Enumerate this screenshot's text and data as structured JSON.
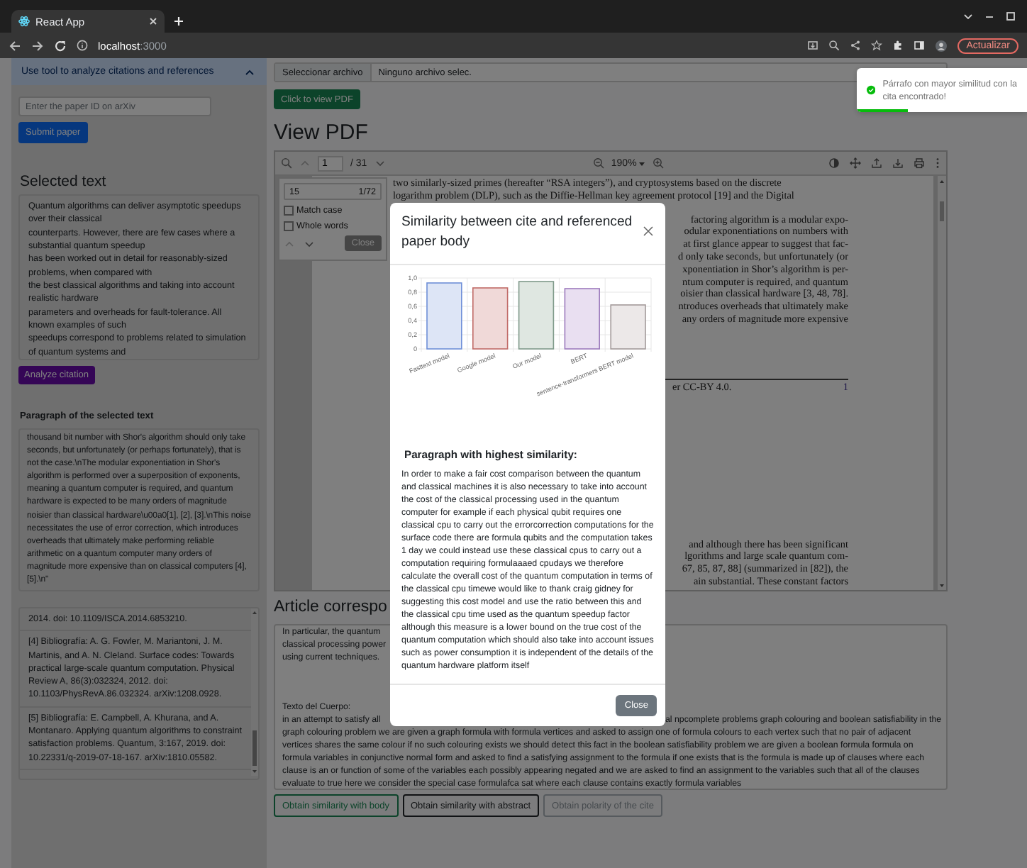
{
  "browser": {
    "tab_title": "React App",
    "address_host": "localhost",
    "address_port": ":3000",
    "update_button": "Actualizar"
  },
  "sidebar": {
    "accordion": {
      "title": "Use tool to analyze citations and references",
      "expanded": true
    },
    "paper_id_field": {
      "placeholder": "Enter the paper ID on arXiv"
    },
    "submit_button": "Submit paper",
    "selected_text_heading": "Selected text",
    "selected_text": "Quantum algorithms can deliver asymptotic speedups over their classical\ncounterparts. However, there are few cases where a substantial quantum speedup\nhas been worked out in detail for reasonably-sized problems, when compared with\nthe best classical algorithms and taking into account realistic hardware\nparameters and overheads for fault-tolerance. All known examples of such\nspeedups correspond to problems related to simulation of quantum systems and",
    "analyze_button": "Analyze citation",
    "paragraph_heading": "Paragraph of the selected text",
    "paragraph_text": "thousand bit number with Shor's algorithm should only take seconds, but unfortunately (or perhaps fortunately), that is not the case.\\nThe modular exponentiation in Shor's algorithm is performed over a superposition of exponents, meaning a quantum computer is required, and quantum hardware is expected to be many orders of magnitude noisier than classical hardware\\u00a0[1], [2], [3].\\nThis noise necessitates the use of error correction, which introduces overheads that ultimately make performing reliable arithmetic on a quantum computer many orders of magnitude more expensive than on classical computers [4], [5].\\n\"",
    "references": [
      "2014. doi: 10.1109/ISCA.2014.6853210.",
      "[4] Bibliografía: A. G. Fowler, M. Mariantoni, J. M. Martinis, and A. N. Cleland. Surface codes: Towards practical large-scale quantum computation. Physical Review A, 86(3):032324, 2012. doi: 10.1103/PhysRevA.86.032324. arXiv:1208.0928.",
      "[5] Bibliografía: E. Campbell, A. Khurana, and A. Montanaro. Applying quantum algorithms to constraint satisfaction problems. Quantum, 3:167, 2019. doi: 10.22331/q-2019-07-18-167. arXiv:1810.05582."
    ]
  },
  "file_input": {
    "button": "Seleccionar archivo",
    "status": "Ninguno archivo selec."
  },
  "view_button": "Click to view PDF",
  "pdf_heading": "View PDF",
  "pdf_viewer": {
    "page_input": "1",
    "page_total": "/ 31",
    "zoom": "190%",
    "search": {
      "query": "15",
      "match_count": "1/72",
      "options": [
        {
          "label": "Match case",
          "checked": false
        },
        {
          "label": "Whole words",
          "checked": false
        }
      ],
      "close_button": "Close"
    },
    "paragraphs": [
      [
        {
          "kind": "full",
          "text": "two similarly-sized primes (hereafter “RSA integers”), and cryptosystems based on the discrete"
        },
        {
          "kind": "full",
          "text": "logarithm problem (DLP), such as the Diffie-Hellman key agreement protocol [19] and the Digital"
        }
      ],
      [
        {
          "kind": "tail",
          "text": "factoring algorithm is a modular expo-"
        },
        {
          "kind": "tail",
          "text": "odular exponentiations on numbers with"
        },
        {
          "kind": "tail",
          "text": "at first glance appear to suggest that fac-"
        },
        {
          "kind": "tail",
          "text": "d only take seconds, but unfortunately (or"
        },
        {
          "kind": "tail",
          "text": "xponentiation in Shor’s algorithm is per-"
        },
        {
          "kind": "tail",
          "text": "ntum computer is required, and quantum"
        },
        {
          "kind": "tail",
          "text": "oisier than classical hardware [3, 48, 78]."
        },
        {
          "kind": "tail",
          "text": "ntroduces overheads that ultimately make"
        },
        {
          "kind": "tail",
          "text": "any orders of magnitude more expensive"
        }
      ]
    ],
    "footnote": "er CC-BY 4.0.",
    "page_number": "1",
    "next_paragraph": [
      {
        "kind": "tail",
        "text": "and although there has been significant"
      },
      {
        "kind": "tail",
        "text": "lgorithms and large scale quantum com-"
      },
      {
        "kind": "tail",
        "text": "67, 85, 87, 88] (summarized in [82]), the"
      },
      {
        "kind": "tail",
        "text": "ain substantial. These constant factors"
      }
    ]
  },
  "article": {
    "heading": "Article correspo",
    "abstract_lines": [
      "In particular, the quantum",
      "classical processing power",
      "using current techniques."
    ],
    "body_label": "Texto del Cuerpo:",
    "body_lines": [
      {
        "kind": "split",
        "left": "in an attempt to satisfy all",
        "right": "al npcomplete problems graph colouring and boolean satisfiability in the"
      },
      {
        "kind": "full",
        "text": "graph colouring problem we are given a graph formula with formula vertices and asked to assign one of formula colours to each vertex such that no pair of adjacent"
      },
      {
        "kind": "full",
        "text": "vertices shares the same colour if no such colouring exists we should detect this fact in the boolean satisfiability problem we are given a boolean formula formula on"
      },
      {
        "kind": "full",
        "text": "formula variables in conjunctive normal form and asked to find a satisfying assignment to the formula if one exists that is the formula is made up of clauses where each"
      },
      {
        "kind": "full",
        "text": "clause is an or function of some of the variables each possibly appearing negated and we are asked to find an assignment to the variables such that all of the clauses"
      },
      {
        "kind": "full",
        "text": "evaluate to true here we consider the special case formulafca sat where each clause contains exactly formula variables"
      }
    ]
  },
  "actions": [
    {
      "label": "Obtain similarity with body",
      "kind": "success"
    },
    {
      "label": "Obtain similarity with abstract",
      "kind": "dark"
    },
    {
      "label": "Obtain polarity of the cite",
      "kind": "secondary"
    }
  ],
  "modal": {
    "title": "Similarity between cite and referenced paper body",
    "chart_data": {
      "type": "bar",
      "categories": [
        "Fasttext model",
        "Google model",
        "Our model",
        "BERT",
        "sentence-transformers BERT model"
      ],
      "values": [
        0.93,
        0.86,
        0.95,
        0.85,
        0.62
      ],
      "ylim": [
        0,
        1
      ],
      "grid": true,
      "yticks": [
        {
          "value": 0,
          "label": "0"
        },
        {
          "value": 0.2,
          "label": "0,2"
        },
        {
          "value": 0.4,
          "label": "0,4"
        },
        {
          "value": 0.6,
          "label": "0,6"
        },
        {
          "value": 0.8,
          "label": "0,8"
        },
        {
          "value": 1,
          "label": "1,0"
        }
      ]
    },
    "paragraph_heading": "Paragraph with highest similarity:",
    "paragraph_text": "In order to make a fair cost comparison between the quantum and classical machines it is also necessary to take into account the cost of the classical processing used in the quantum computer for example if each physical qubit requires one classical cpu to carry out the errorcorrection computations for the surface code there are formula qubits and the computation takes 1 day we could instead use these classical cpus to carry out a computation requiring formulaaaed cpudays we therefore calculate the overall cost of the quantum computation in terms of the classical cpu timewe would like to thank craig gidney for suggesting this cost model and use the ratio between this and the classical cpu time used as the quantum speedup factor although this measure is a lower bound on the true cost of the quantum computation which should also take into account issues such as power consumption it is independent of the details of the quantum hardware platform itself",
    "close_button": "Close"
  },
  "toast": {
    "message": "Párrafo con mayor similitud con la cita encontrado!",
    "level": 0.3
  }
}
